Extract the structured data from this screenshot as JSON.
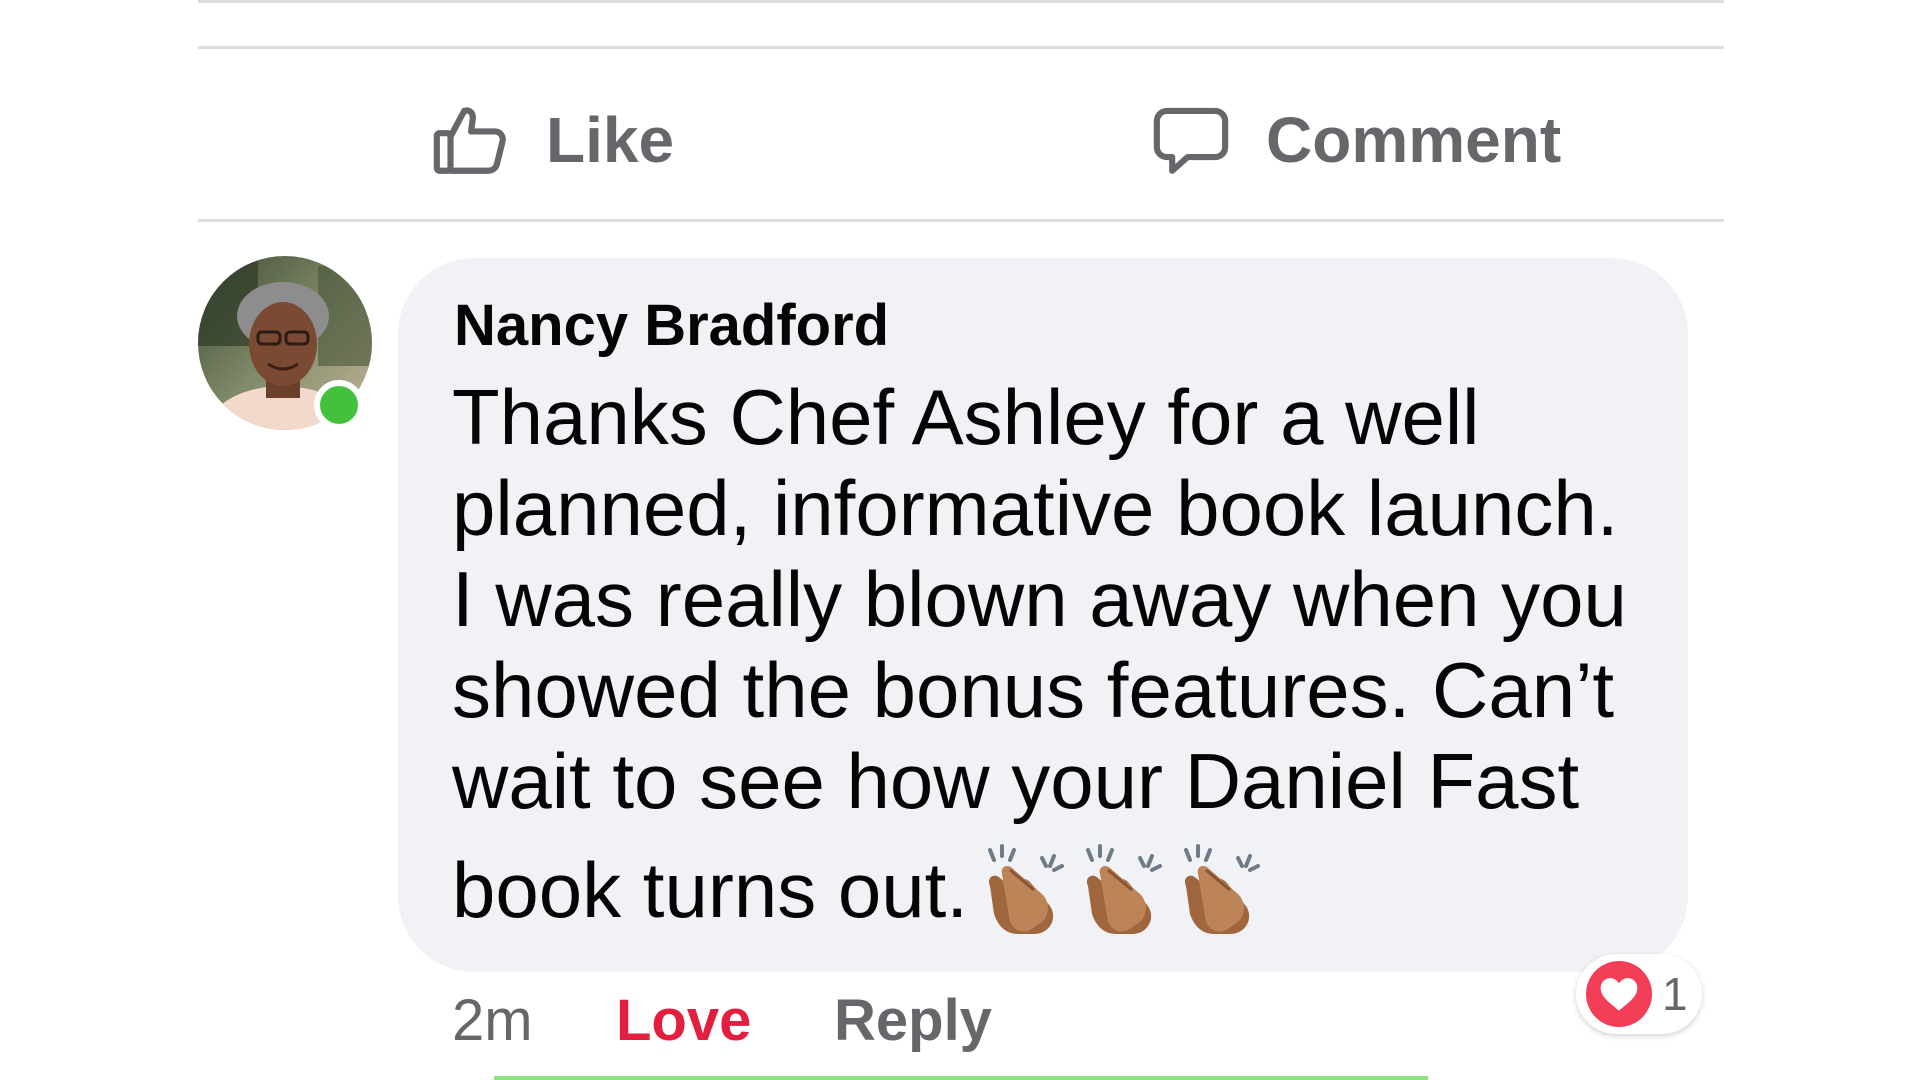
{
  "actions": {
    "like_label": "Like",
    "comment_label": "Comment",
    "like_icon": "thumbs-up-outline",
    "comment_icon": "speech-bubble-outline"
  },
  "comment": {
    "author": "Nancy Bradford",
    "text_lines": [
      "Thanks Chef Ashley for a well",
      "planned, informative book launch.",
      "I was really blown away when you",
      "showed the bonus features. Can’t",
      "wait to see how your Daniel Fast",
      "book turns out."
    ],
    "emoji": [
      "clapping-hands",
      "clapping-hands",
      "clapping-hands"
    ],
    "timestamp": "2m",
    "love_label": "Love",
    "reply_label": "Reply",
    "reaction": {
      "icon": "heart",
      "count": "1"
    },
    "author_online": true
  },
  "colors": {
    "love": "#e41e3f",
    "heart_badge": "#f33e58",
    "online": "#44c13c",
    "bubble": "#f0f2f5",
    "secondary_text": "#65676b"
  }
}
